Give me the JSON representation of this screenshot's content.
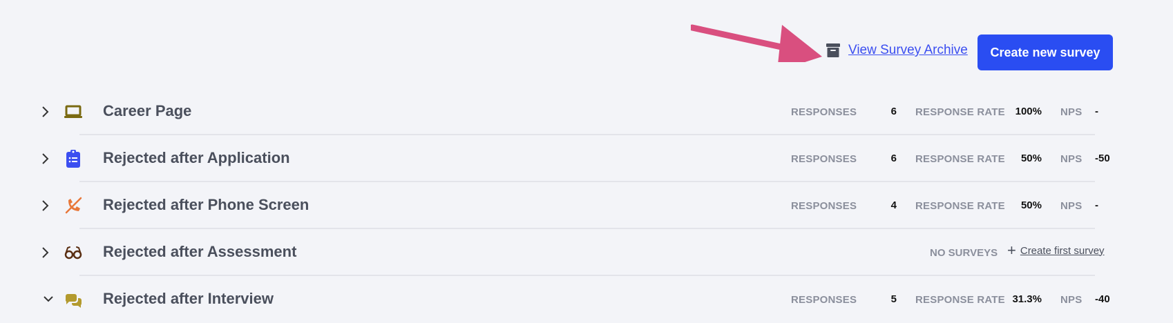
{
  "header": {
    "archive_link_label": "View Survey Archive",
    "archive_icon": "archive-box-icon",
    "create_button_label": "Create new survey",
    "accent_color": "#2a4df2",
    "annotation_arrow_color": "#d94f7f"
  },
  "stat_labels": {
    "responses": "RESPONSES",
    "response_rate": "RESPONSE RATE",
    "nps": "NPS"
  },
  "rows": [
    {
      "title": "Career Page",
      "icon": "laptop-icon",
      "expanded": false,
      "responses": "6",
      "response_rate": "100%",
      "nps": "-"
    },
    {
      "title": "Rejected after Application",
      "icon": "clipboard-list-icon",
      "expanded": false,
      "responses": "6",
      "response_rate": "50%",
      "nps": "-50"
    },
    {
      "title": "Rejected after Phone Screen",
      "icon": "phone-slash-icon",
      "expanded": false,
      "responses": "4",
      "response_rate": "50%",
      "nps": "-"
    },
    {
      "title": "Rejected after Assessment",
      "icon": "glasses-icon",
      "expanded": false,
      "no_surveys_label": "NO SURVEYS",
      "create_first_label": "Create first survey"
    },
    {
      "title": "Rejected after Interview",
      "icon": "chat-bubbles-icon",
      "expanded": true,
      "responses": "5",
      "response_rate": "31.3%",
      "nps": "-40"
    }
  ]
}
